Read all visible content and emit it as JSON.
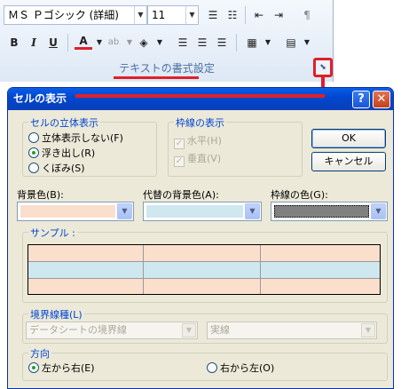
{
  "ribbon": {
    "font_name": "ＭＳ Ｐゴシック (詳細)",
    "font_size": "11",
    "bold": "B",
    "italic": "I",
    "underline": "U",
    "group_label": "テキストの書式設定"
  },
  "dialog": {
    "title": "セルの表示",
    "help_glyph": "?",
    "close_glyph": "✕",
    "cell_effect": {
      "legend": "セルの立体表示",
      "options": [
        "立体表示しない(F)",
        "浮き出し(R)",
        "くぼみ(S)"
      ],
      "selected": 1
    },
    "gridlines": {
      "legend": "枠線の表示",
      "options": [
        "水平(H)",
        "垂直(V)"
      ]
    },
    "ok_label": "OK",
    "cancel_label": "キャンセル",
    "background_color": {
      "label": "背景色(B):",
      "value": "#fbdfcd"
    },
    "alt_background_color": {
      "label": "代替の背景色(A):",
      "value": "#cfe7ef"
    },
    "gridline_color": {
      "label": "枠線の色(G):",
      "value": "#808080"
    },
    "sample": {
      "legend": "サンプル :"
    },
    "border_style": {
      "legend": "境界線種(L)",
      "left_value": "データシートの境界線",
      "right_value": "実線"
    },
    "direction": {
      "legend": "方向",
      "options": [
        "左から右(E)",
        "右から左(O)"
      ],
      "selected": 0
    }
  }
}
